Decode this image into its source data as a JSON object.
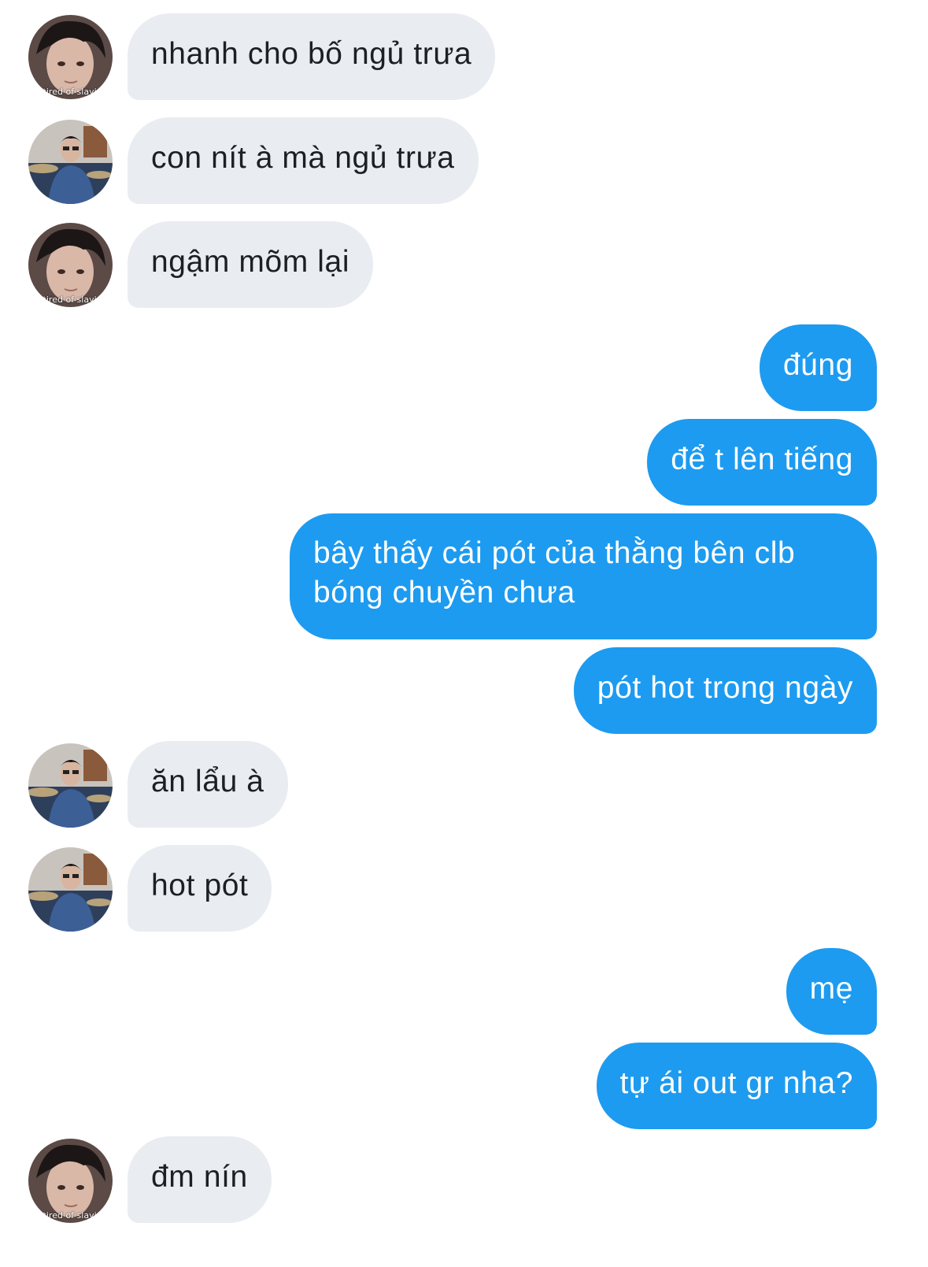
{
  "colors": {
    "incoming_bubble": "#e9ecf0",
    "incoming_text": "#1c2025",
    "outgoing_bubble": "#1d9bf0",
    "outgoing_text": "#ffffff"
  },
  "avatars": {
    "a": {
      "icon": "avatar-face-photo",
      "caption": "i tired of slayin"
    },
    "b": {
      "icon": "avatar-drummer-photo"
    }
  },
  "messages": [
    {
      "from": "in",
      "avatar": "a",
      "text": "nhanh cho bố ngủ trưa"
    },
    {
      "from": "in",
      "avatar": "b",
      "text": "con nít à mà ngủ trưa"
    },
    {
      "from": "in",
      "avatar": "a",
      "text": "ngậm mõm lại"
    },
    {
      "from": "out",
      "text": "đúng"
    },
    {
      "from": "out",
      "text": "để t lên tiếng"
    },
    {
      "from": "out",
      "text": "bây thấy cái pót của thằng bên clb bóng chuyền chưa"
    },
    {
      "from": "out",
      "text": "pót hot trong ngày"
    },
    {
      "from": "in",
      "avatar": "b",
      "text": "ăn lẩu à"
    },
    {
      "from": "in",
      "avatar": "b",
      "text": "hot pót"
    },
    {
      "from": "out",
      "text": "mẹ"
    },
    {
      "from": "out",
      "text": "tự ái out gr nha?"
    },
    {
      "from": "in",
      "avatar": "a",
      "text": "đm nín"
    }
  ]
}
